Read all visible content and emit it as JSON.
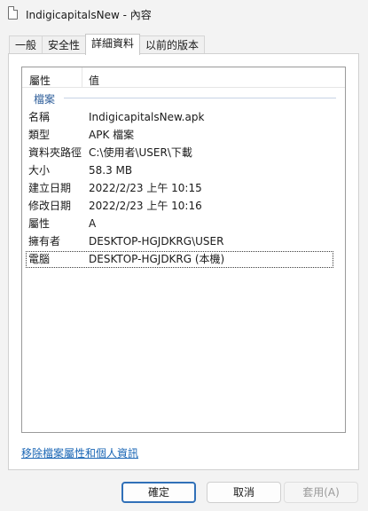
{
  "window": {
    "title": "IndigicapitalsNew - 內容"
  },
  "tabs": [
    {
      "label": "一般",
      "active": false
    },
    {
      "label": "安全性",
      "active": false
    },
    {
      "label": "詳細資料",
      "active": true
    },
    {
      "label": "以前的版本",
      "active": false
    }
  ],
  "list": {
    "header": {
      "property": "屬性",
      "value": "值"
    },
    "group_label": "檔案",
    "rows": [
      {
        "key": "名稱",
        "value": "IndigicapitalsNew.apk"
      },
      {
        "key": "類型",
        "value": "APK 檔案"
      },
      {
        "key": "資料夾路徑",
        "value": "C:\\使用者\\USER\\下載"
      },
      {
        "key": "大小",
        "value": "58.3 MB"
      },
      {
        "key": "建立日期",
        "value": "2022/2/23 上午 10:15"
      },
      {
        "key": "修改日期",
        "value": "2022/2/23 上午 10:16"
      },
      {
        "key": "屬性",
        "value": "A"
      },
      {
        "key": "擁有者",
        "value": "DESKTOP-HGJDKRG\\USER"
      },
      {
        "key": "電腦",
        "value": "DESKTOP-HGJDKRG (本機)"
      }
    ]
  },
  "remove_link": "移除檔案屬性和個人資訊",
  "buttons": {
    "ok": "確定",
    "cancel": "取消",
    "apply": "套用(A)"
  },
  "colors": {
    "link": "#1a66b5",
    "group_label": "#2e5e9a",
    "ok_border": "#3070b8"
  }
}
